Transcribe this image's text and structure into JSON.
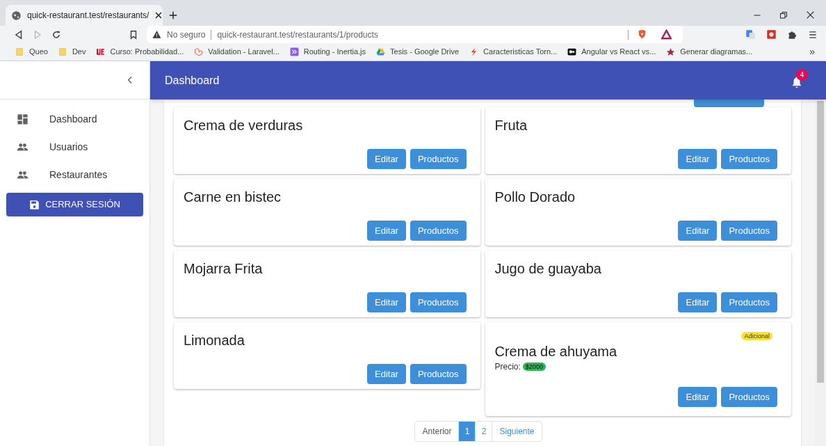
{
  "browser": {
    "tab": {
      "title": "quick-restaurant.test/restaurants/",
      "selected": true
    },
    "address": {
      "warning": "No seguro",
      "url": "quick-restaurant.test/restaurants/1/products"
    },
    "bookmarks": [
      {
        "label": "Queo",
        "kind": "folder"
      },
      {
        "label": "Dev",
        "kind": "folder"
      },
      {
        "label": "Curso: Probabilidad...",
        "kind": "red"
      },
      {
        "label": "Validation - Laravel...",
        "kind": "laravel"
      },
      {
        "label": "Routing - Inertia.js",
        "kind": "inertia"
      },
      {
        "label": "Tesis - Google Drive",
        "kind": "drive"
      },
      {
        "label": "Caracteristicas Torn...",
        "kind": "flame"
      },
      {
        "label": "Angular vs React vs...",
        "kind": "dark"
      },
      {
        "label": "Generar diagramas...",
        "kind": "star"
      }
    ],
    "more": "»"
  },
  "sidebar": {
    "items": [
      {
        "label": "Dashboard",
        "kind": "dashboard"
      },
      {
        "label": "Usuarios",
        "kind": "people"
      },
      {
        "label": "Restaurantes",
        "kind": "people"
      }
    ],
    "logout": "CERRAR SESIÓN"
  },
  "header": {
    "title": "Dashboard",
    "notifications": "4"
  },
  "products": [
    {
      "name": "Crema de verduras",
      "buttons": [
        "Editar",
        "Productos"
      ]
    },
    {
      "name": "Fruta",
      "buttons": [
        "Editar",
        "Productos"
      ]
    },
    {
      "name": "Carne en bistec",
      "buttons": [
        "Editar",
        "Productos"
      ]
    },
    {
      "name": "Pollo Dorado",
      "buttons": [
        "Editar",
        "Productos"
      ]
    },
    {
      "name": "Mojarra Frita",
      "buttons": [
        "Editar",
        "Productos"
      ]
    },
    {
      "name": "Jugo de guayaba",
      "buttons": [
        "Editar",
        "Productos"
      ]
    },
    {
      "name": "Limonada",
      "buttons": [
        "Editar",
        "Productos"
      ]
    },
    {
      "name": "Crema de ahuyama",
      "badge": "Adicional",
      "price_label": "Precio:",
      "price": "$2000",
      "buttons": [
        "Editar",
        "Productos"
      ]
    }
  ],
  "pagination": {
    "previous": "Anterior",
    "pages": [
      {
        "label": "1",
        "selected": true
      },
      {
        "label": "2",
        "selected": false
      }
    ],
    "next": "Siguiente"
  }
}
